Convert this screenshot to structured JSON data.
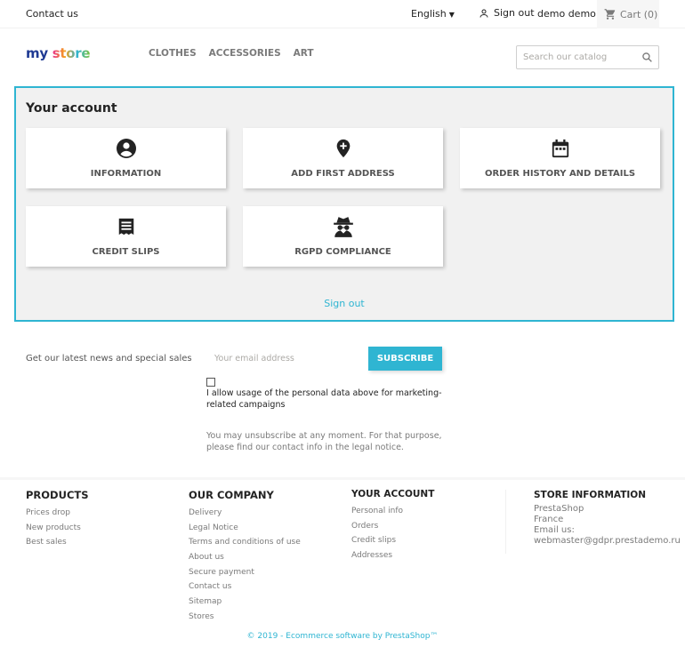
{
  "topbar": {
    "contact": "Contact us",
    "language": "English",
    "sign_out": "Sign out",
    "user_name": "demo demo",
    "cart": "Cart (0)"
  },
  "header": {
    "logo_part1": "my",
    "logo_part2": "store",
    "nav": [
      "CLOTHES",
      "ACCESSORIES",
      "ART"
    ],
    "search_placeholder": "Search our catalog"
  },
  "account": {
    "title": "Your account",
    "tiles": [
      {
        "label": "INFORMATION",
        "icon": "account-circle-icon"
      },
      {
        "label": "ADD FIRST ADDRESS",
        "icon": "add-location-icon"
      },
      {
        "label": "ORDER HISTORY AND DETAILS",
        "icon": "calendar-icon"
      },
      {
        "label": "CREDIT SLIPS",
        "icon": "receipt-icon"
      },
      {
        "label": "RGPD COMPLIANCE",
        "icon": "incognito-icon"
      }
    ],
    "sign_out": "Sign out"
  },
  "newsletter": {
    "label": "Get our latest news and special sales",
    "email_placeholder": "Your email address",
    "subscribe": "SUBSCRIBE",
    "consent": "I allow usage of the personal data above for marketing-related campaigns",
    "unsubscribe_note": "You may unsubscribe at any moment. For that purpose, please find our contact info in the legal notice."
  },
  "footer": {
    "products": {
      "title": "PRODUCTS",
      "links": [
        "Prices drop",
        "New products",
        "Best sales"
      ]
    },
    "company": {
      "title": "OUR COMPANY",
      "links": [
        "Delivery",
        "Legal Notice",
        "Terms and conditions of use",
        "About us",
        "Secure payment",
        "Contact us",
        "Sitemap",
        "Stores"
      ]
    },
    "your_account": {
      "title": "YOUR ACCOUNT",
      "links": [
        "Personal info",
        "Orders",
        "Credit slips",
        "Addresses"
      ]
    },
    "store_info": {
      "title": "STORE INFORMATION",
      "name": "PrestaShop",
      "country": "France",
      "email_label": "Email us:",
      "email": "webmaster@gdpr.prestademo.ru"
    },
    "copyright": "© 2019 - Ecommerce software by PrestaShop™"
  },
  "colors": {
    "accent": "#2fb5d2",
    "account_bg": "#f1f1f1"
  }
}
